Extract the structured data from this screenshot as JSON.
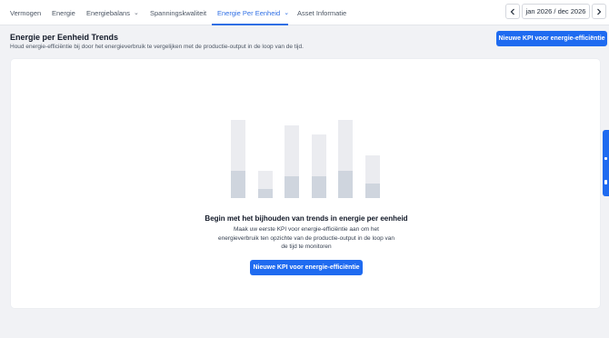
{
  "nav": {
    "tabs": [
      {
        "label": "Vermogen",
        "dropdown": false,
        "active": false
      },
      {
        "label": "Energie",
        "dropdown": false,
        "active": false
      },
      {
        "label": "Energiebalans",
        "dropdown": true,
        "active": false
      },
      {
        "label": "Spanningskwaliteit",
        "dropdown": false,
        "active": false
      },
      {
        "label": "Energie Per Eenheid",
        "dropdown": true,
        "active": true
      },
      {
        "label": "Asset Informatie",
        "dropdown": false,
        "active": false
      }
    ],
    "date_range": "jan 2026 / dec 2026",
    "prev_icon": "chevron-left-icon",
    "next_icon": "chevron-right-icon"
  },
  "header": {
    "title": "Energie per Eenheid Trends",
    "subtitle": "Houd energie-efficiëntie bij door het energieverbruik te vergelijken met de productie-output in de loop van de tijd.",
    "new_kpi_button": "Nieuwe KPI voor energie-efficiëntie"
  },
  "empty_state": {
    "title": "Begin met het bijhouden van trends in energie per eenheid",
    "description": "Maak uw eerste KPI voor energie-efficiëntie aan om het energieverbruik ten opzichte van de productie-output in de loop van de tijd te monitoren",
    "button": "Nieuwe KPI voor energie-efficiëntie",
    "illustration_bars": [
      {
        "total": 1.0,
        "filled": 0.35
      },
      {
        "total": 0.35,
        "filled": 0.12
      },
      {
        "total": 0.93,
        "filled": 0.28
      },
      {
        "total": 0.81,
        "filled": 0.28
      },
      {
        "total": 1.0,
        "filled": 0.35
      },
      {
        "total": 0.55,
        "filled": 0.19
      }
    ]
  },
  "colors": {
    "accent": "#1f6bf0",
    "active_tab": "#2f6fe4",
    "bar_background": "#ebecf0",
    "bar_fill": "#cfd5de",
    "page_background": "#f1f2f5"
  }
}
